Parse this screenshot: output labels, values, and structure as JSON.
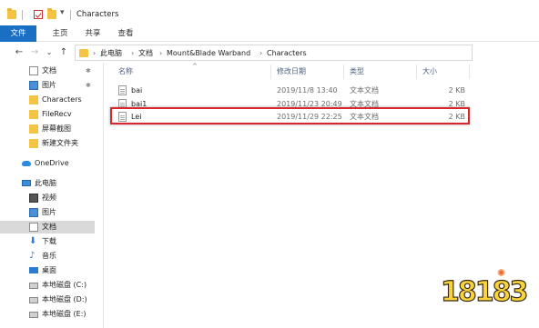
{
  "window": {
    "title": "Characters"
  },
  "ribbon": {
    "tabs": [
      "文件",
      "主页",
      "共享",
      "查看"
    ]
  },
  "address": {
    "crumbs": [
      "此电脑",
      "文档",
      "Mount&Blade Warband",
      "Characters"
    ]
  },
  "nav_pane": {
    "quick_access": [
      {
        "label": "文档",
        "icon": "document-icon",
        "pinned": true
      },
      {
        "label": "图片",
        "icon": "picture-icon",
        "pinned": true
      },
      {
        "label": "Characters",
        "icon": "folder-icon",
        "pinned": false
      },
      {
        "label": "FileRecv",
        "icon": "folder-icon",
        "pinned": false
      },
      {
        "label": "屏幕截图",
        "icon": "folder-icon",
        "pinned": false
      },
      {
        "label": "新建文件夹",
        "icon": "folder-icon",
        "pinned": false
      }
    ],
    "onedrive": "OneDrive",
    "this_pc": "此电脑",
    "pc_items": [
      {
        "label": "视频",
        "icon": "video-icon"
      },
      {
        "label": "图片",
        "icon": "picture-icon"
      },
      {
        "label": "文档",
        "icon": "document-icon",
        "selected": true
      },
      {
        "label": "下载",
        "icon": "download-icon"
      },
      {
        "label": "音乐",
        "icon": "music-icon"
      },
      {
        "label": "桌面",
        "icon": "desktop-icon"
      },
      {
        "label": "本地磁盘 (C:)",
        "icon": "drive-icon"
      },
      {
        "label": "本地磁盘 (D:)",
        "icon": "drive-icon"
      },
      {
        "label": "本地磁盘 (E:)",
        "icon": "drive-icon"
      }
    ]
  },
  "file_list": {
    "columns": [
      "名称",
      "修改日期",
      "类型",
      "大小"
    ],
    "rows": [
      {
        "name": "bai",
        "date": "2019/11/8 13:40",
        "type": "文本文档",
        "size": "2 KB"
      },
      {
        "name": "bai1",
        "date": "2019/11/23 20:49",
        "type": "文本文档",
        "size": "2 KB"
      },
      {
        "name": "Lei",
        "date": "2019/11/29 22:25",
        "type": "文本文档",
        "size": "2 KB",
        "highlighted": true
      }
    ]
  },
  "watermark": {
    "text": "18183"
  },
  "colors": {
    "file_tab": "#1a6fc4",
    "highlight_border": "#d8282e",
    "folder": "#f5c342"
  }
}
